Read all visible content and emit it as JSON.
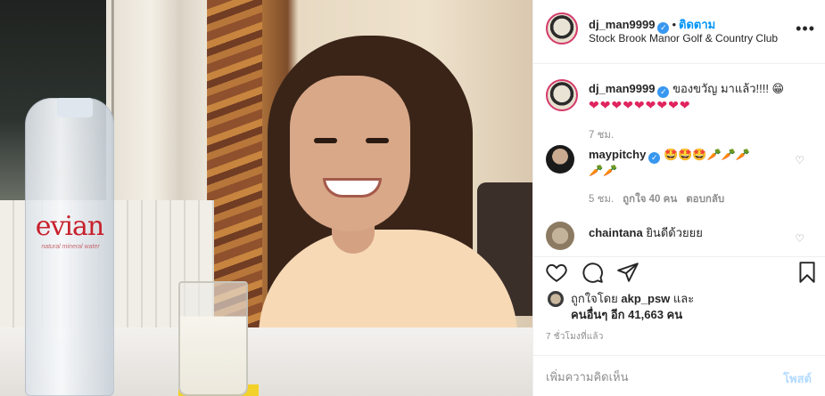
{
  "header": {
    "username": "dj_man9999",
    "verified_icon": "verified-badge-icon",
    "separator": "•",
    "follow_label": "ติดตาม",
    "location": "Stock Brook Manor Golf & Country Club",
    "more_icon": "more-options-icon"
  },
  "photo": {
    "bottle_brand": "evian",
    "bottle_subtext": "natural mineral water"
  },
  "caption": {
    "username": "dj_man9999",
    "text": "ของขวัญ มาแล้ว!!!! 😁",
    "hearts": "❤❤❤❤❤❤❤❤❤",
    "time": "7 ชม."
  },
  "comments": [
    {
      "username": "maypitchy",
      "text": "🤩🤩🤩🥕🥕🥕",
      "text2": "🥕🥕",
      "time": "5 ชม.",
      "likes": "ถูกใจ 40 คน",
      "reply": "ตอบกลับ"
    },
    {
      "username": "chaintana",
      "text": "ยินดีด้วยยย"
    }
  ],
  "actions": {
    "like_icon": "heart-icon",
    "comment_icon": "comment-bubble-icon",
    "share_icon": "share-arrow-icon",
    "save_icon": "bookmark-icon"
  },
  "likes": {
    "prefix": "ถูกใจโดย",
    "user": "akp_psw",
    "suffix": "และ",
    "others": "คนอื่นๆ อีก 41,663 คน"
  },
  "timestamp": "7 ชั่วโมงที่แล้ว",
  "add_comment": {
    "placeholder": "เพิ่มความคิดเห็น",
    "post_label": "โพสต์"
  },
  "colors": {
    "accent": "#0095f6",
    "heart": "#e0245e",
    "verified": "#3897f0"
  }
}
